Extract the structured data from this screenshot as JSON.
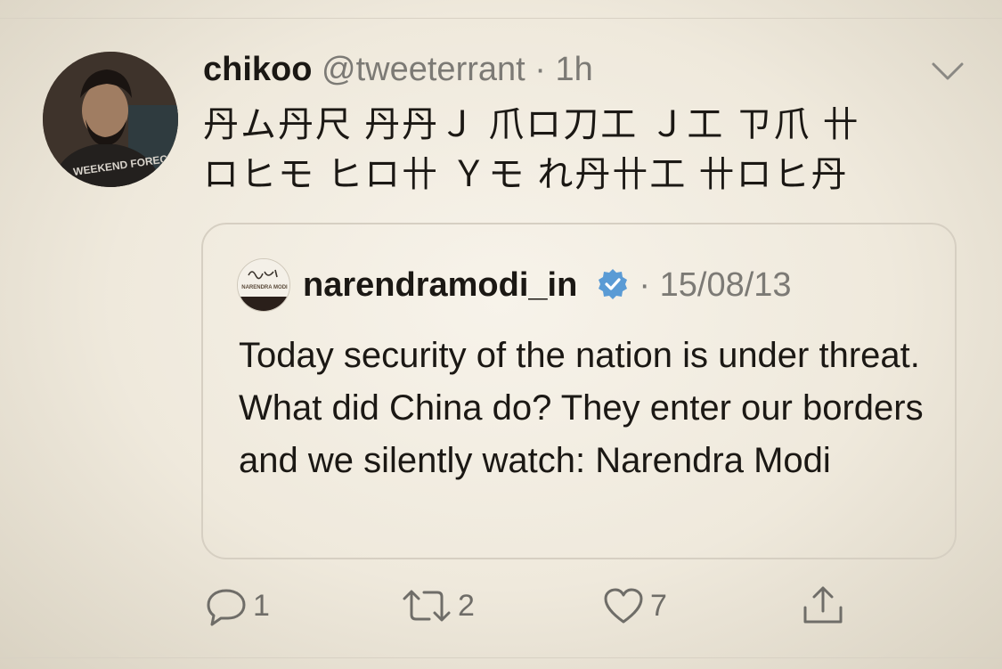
{
  "tweet": {
    "user_name": "chikoo",
    "user_handle": "@tweeterrant",
    "separator": "·",
    "time": "1h",
    "text_lines": [
      "丹ム丹尺 丹丹Ｊ 爪ロ刀工 Ｊ工 ㄗ爪 卄",
      "ロヒモ ヒロ卄 Ｙモ れ丹卄工 卄ロヒ丹"
    ]
  },
  "quoted": {
    "name": "narendramodi_in",
    "separator": "·",
    "date": "15/08/13",
    "text": "Today security of the nation is under threat. What did China do? They enter our borders and we silently watch: Narendra Modi",
    "avatar_caption": "NARENDRA MODI"
  },
  "actions": {
    "reply_count": "1",
    "retweet_count": "2",
    "like_count": "7"
  },
  "colors": {
    "background": "#f2ede3",
    "text": "#1b1814",
    "muted": "#7c7a75",
    "verified": "#5a9bd5",
    "border": "#d6cfc2"
  },
  "icons": {
    "menu": "chevron-down-icon",
    "verified": "verified-badge-icon",
    "reply": "reply-icon",
    "retweet": "retweet-icon",
    "like": "heart-icon",
    "share": "share-icon"
  }
}
